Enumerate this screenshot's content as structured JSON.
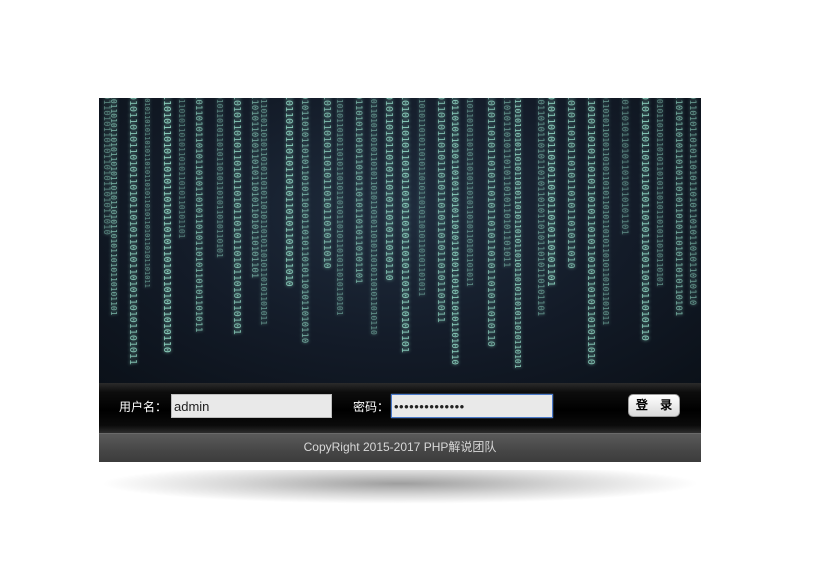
{
  "login": {
    "username_label": "用户名：",
    "username_value": "admin",
    "password_label": "密码：",
    "password_value": "••••••••••••••",
    "submit_label": "登 录"
  },
  "footer": {
    "copyright": "CopyRight 2015-2017 PHP解说团队"
  },
  "colors": {
    "banner_bg": "#131b28",
    "binary_glyph": "#8fd6c2",
    "bar_bg": "#000000",
    "footer_bg": "#4a4a4a",
    "footer_text": "#d8d8d8"
  }
}
